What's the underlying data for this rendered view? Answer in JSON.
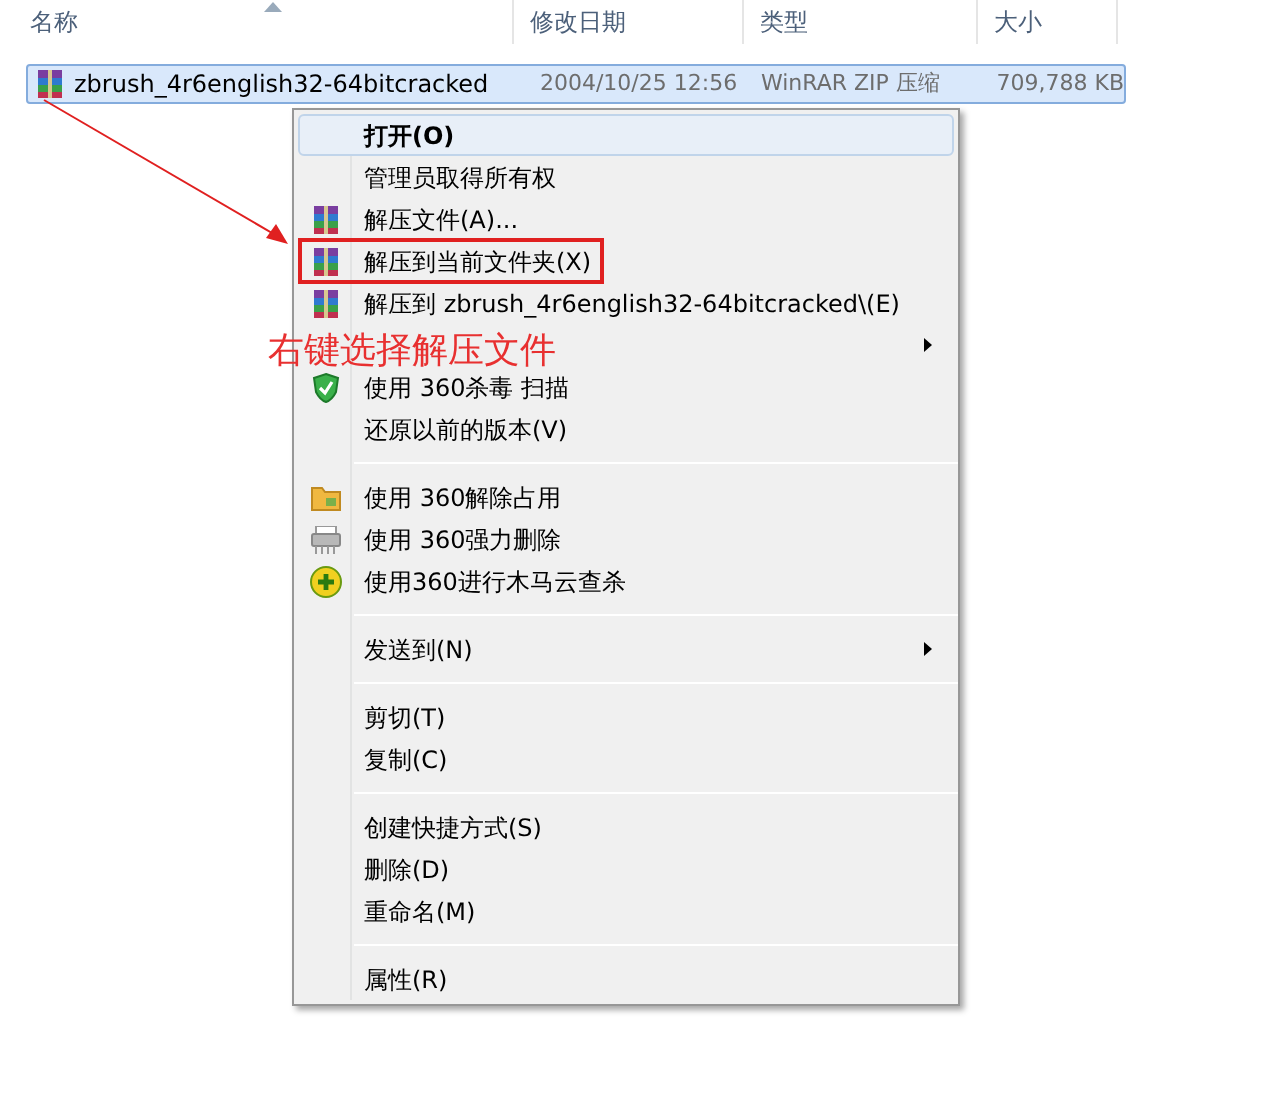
{
  "columns": [
    {
      "label": "名称",
      "sorted": true
    },
    {
      "label": "修改日期"
    },
    {
      "label": "类型"
    },
    {
      "label": "大小"
    }
  ],
  "file": {
    "name": "zbrush_4r6english32-64bitcracked",
    "date": "2004/10/25 12:56",
    "type": "WinRAR ZIP 压缩",
    "size": "709,788 KB",
    "selected": true
  },
  "menu": [
    {
      "kind": "item",
      "label": "打开(O)",
      "bold": true,
      "selected": true
    },
    {
      "kind": "item",
      "label": "管理员取得所有权",
      "selected": false
    },
    {
      "kind": "archive",
      "label": "解压文件(A)...",
      "selected": false
    },
    {
      "kind": "archive",
      "label": "解压到当前文件夹(X)",
      "selected": false,
      "boxed": true
    },
    {
      "kind": "archive",
      "label": "解压到 zbrush_4r6english32-64bitcracked\\(E)",
      "selected": false
    },
    {
      "kind": "item",
      "submenu": true
    },
    {
      "kind": "shield",
      "label": "使用 360杀毒 扫描",
      "selected": false
    },
    {
      "kind": "item",
      "label": "还原以前的版本(V)",
      "selected": false
    },
    {
      "kind": "separator"
    },
    {
      "kind": "folder",
      "label": "使用 360解除占用",
      "selected": false
    },
    {
      "kind": "shredder",
      "label": "使用 360强力删除",
      "selected": false
    },
    {
      "kind": "plus",
      "label": "使用360进行木马云查杀",
      "selected": false
    },
    {
      "kind": "separator"
    },
    {
      "kind": "item",
      "label": "发送到(N)",
      "submenu": true,
      "selected": false
    },
    {
      "kind": "separator"
    },
    {
      "kind": "item",
      "label": "剪切(T)",
      "selected": false
    },
    {
      "kind": "item",
      "label": "复制(C)",
      "selected": false
    },
    {
      "kind": "separator"
    },
    {
      "kind": "item",
      "label": "创建快捷方式(S)",
      "selected": false
    },
    {
      "kind": "item",
      "label": "删除(D)",
      "selected": false
    },
    {
      "kind": "item",
      "label": "重命名(M)",
      "selected": false
    },
    {
      "kind": "separator"
    },
    {
      "kind": "item",
      "label": "属性(R)",
      "selected": false
    }
  ],
  "annotation": {
    "text": "右键选择解压文件"
  }
}
